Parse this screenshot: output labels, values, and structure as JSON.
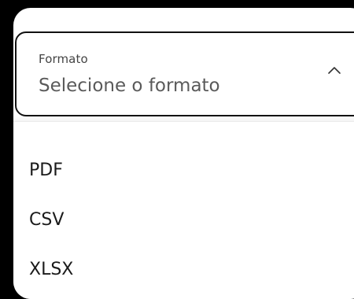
{
  "field": {
    "label": "Formato",
    "placeholder": "Selecione o formato",
    "icon": "chevron-up-icon"
  },
  "menu": {
    "options": [
      "PDF",
      "CSV",
      "XLSX"
    ]
  },
  "colors": {
    "background": "#000000",
    "surface": "#ffffff",
    "border": "#111111",
    "text": "#1a1a1a",
    "muted": "#5a5a5a"
  }
}
